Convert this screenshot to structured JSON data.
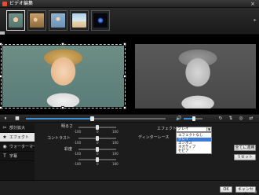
{
  "window": {
    "title": "ビデオ編集",
    "close": "×"
  },
  "filmstrip": {
    "scroll_right": "▸"
  },
  "transport": {
    "pause": "⏸",
    "stop": "■",
    "progress": 0.47,
    "volume_icon": "🔊",
    "volume": 0.55,
    "rotate": "↻",
    "flip_v": "⇅",
    "snapshot": "◎",
    "flip_h": "⇄"
  },
  "sidebar": {
    "items": [
      {
        "icon": "✂",
        "label": "部分拡大"
      },
      {
        "icon": "★",
        "label": "エフェクト"
      },
      {
        "icon": "◉",
        "label": "ウォーターマーク"
      },
      {
        "icon": "T",
        "label": "字幕"
      }
    ]
  },
  "adjust": {
    "brightness": {
      "label": "明るさ",
      "min": "-100",
      "mid": "0",
      "max": "100",
      "value": 0
    },
    "contrast": {
      "label": "コントラスト",
      "min": "-100",
      "mid": "0",
      "max": "100",
      "value": 0
    },
    "saturation": {
      "label": "彩度",
      "min": "-100",
      "mid": "0",
      "max": "100",
      "value": 0
    },
    "hue": {
      "label": "",
      "min": "-180",
      "mid": "0",
      "max": "180",
      "value": 0
    }
  },
  "effect": {
    "label": "エフェクト",
    "selected": "グレイ",
    "options": [
      "エフェクトなし",
      "グレイ",
      "エンボス",
      "ネガティブ",
      "セピア"
    ],
    "deinterlace_label": "ディンターレース"
  },
  "buttons": {
    "apply_all": "全てに適用",
    "reset": "リセット",
    "ok": "OK",
    "cancel": "キャンセル"
  },
  "colors": {
    "accent": "#3d8fd6",
    "selection": "#3d7bd6"
  }
}
